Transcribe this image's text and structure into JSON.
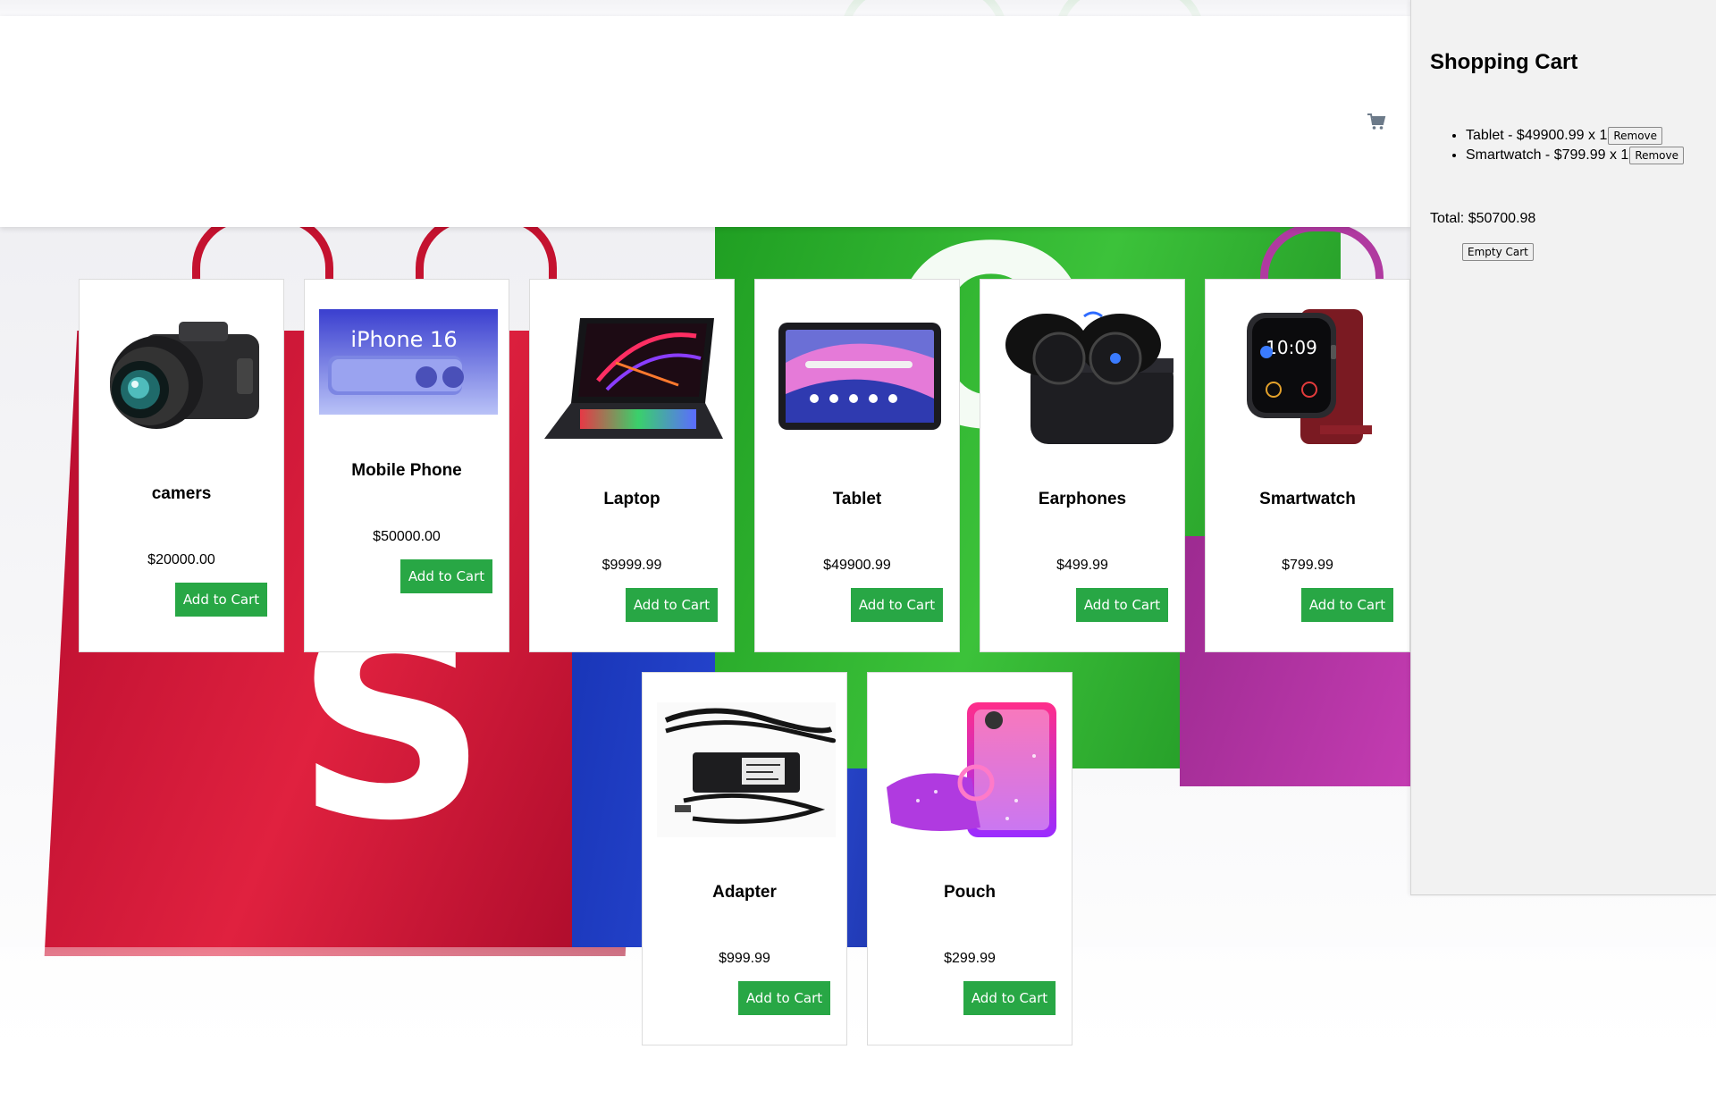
{
  "header": {
    "cart_icon": "shopping-cart-icon"
  },
  "products": [
    {
      "name": "camers",
      "price": "$20000.00",
      "button": "Add to Cart",
      "icon": "camera-image"
    },
    {
      "name": "Mobile Phone",
      "price": "$50000.00",
      "button": "Add to Cart",
      "icon": "phone-image",
      "image_text": "iPhone 16"
    },
    {
      "name": "Laptop",
      "price": "$9999.99",
      "button": "Add to Cart",
      "icon": "laptop-image"
    },
    {
      "name": "Tablet",
      "price": "$49900.99",
      "button": "Add to Cart",
      "icon": "tablet-image"
    },
    {
      "name": "Earphones",
      "price": "$499.99",
      "button": "Add to Cart",
      "icon": "earphones-image"
    },
    {
      "name": "Smartwatch",
      "price": "$799.99",
      "button": "Add to Cart",
      "icon": "smartwatch-image",
      "image_text": "10:09"
    },
    {
      "name": "Adapter",
      "price": "$999.99",
      "button": "Add to Cart",
      "icon": "adapter-image"
    },
    {
      "name": "Pouch",
      "price": "$299.99",
      "button": "Add to Cart",
      "icon": "pouch-image"
    }
  ],
  "cart": {
    "title": "Shopping Cart",
    "items": [
      {
        "text": "Tablet - $49900.99 x 1",
        "remove_label": "Remove"
      },
      {
        "text": "Smartwatch - $799.99 x 1",
        "remove_label": "Remove"
      }
    ],
    "total": "Total: $50700.98",
    "empty_label": "Empty Cart"
  },
  "colors": {
    "add_button": "#28a745",
    "bag_red": "#d3143a",
    "bag_green": "#2fae2f",
    "bag_blue": "#1e3bbf",
    "bag_purple": "#b0309e"
  }
}
